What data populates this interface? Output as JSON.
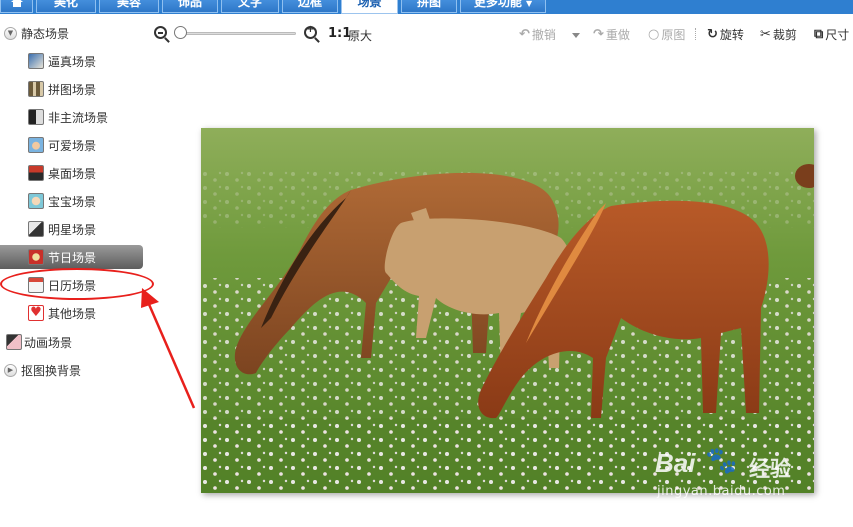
{
  "topbar": {
    "tabs": [
      {
        "label": "",
        "icon": "home-icon"
      },
      {
        "label": "美化"
      },
      {
        "label": "美容"
      },
      {
        "label": "饰品"
      },
      {
        "label": "文字"
      },
      {
        "label": "边框"
      },
      {
        "label": "场景",
        "active": true
      },
      {
        "label": "拼图"
      },
      {
        "label": "更多功能"
      }
    ]
  },
  "sidebar": {
    "group_static": "静态场景",
    "items": [
      {
        "label": "逼真场景"
      },
      {
        "label": "拼图场景"
      },
      {
        "label": "非主流场景"
      },
      {
        "label": "可爱场景"
      },
      {
        "label": "桌面场景"
      },
      {
        "label": "宝宝场景"
      },
      {
        "label": "明星场景"
      },
      {
        "label": "节日场景",
        "selected": true
      },
      {
        "label": "日历场景"
      },
      {
        "label": "其他场景"
      }
    ],
    "animated": "动画场景",
    "cutout_bg": "抠图换背景"
  },
  "toolbar": {
    "zoom_ratio": "1:1",
    "original_size": "原大",
    "undo": "撤销",
    "redo": "重做",
    "original": "原图",
    "rotate": "旋转",
    "crop": "裁剪",
    "size": "尺寸"
  },
  "watermark": {
    "brand": "Bai",
    "brand_cn": "经验",
    "url": "jingyan.baidu.com"
  },
  "colors": {
    "topbar": "#2f7fd0",
    "selected_item": "#7a7a7a",
    "annotation": "#e8201c"
  }
}
